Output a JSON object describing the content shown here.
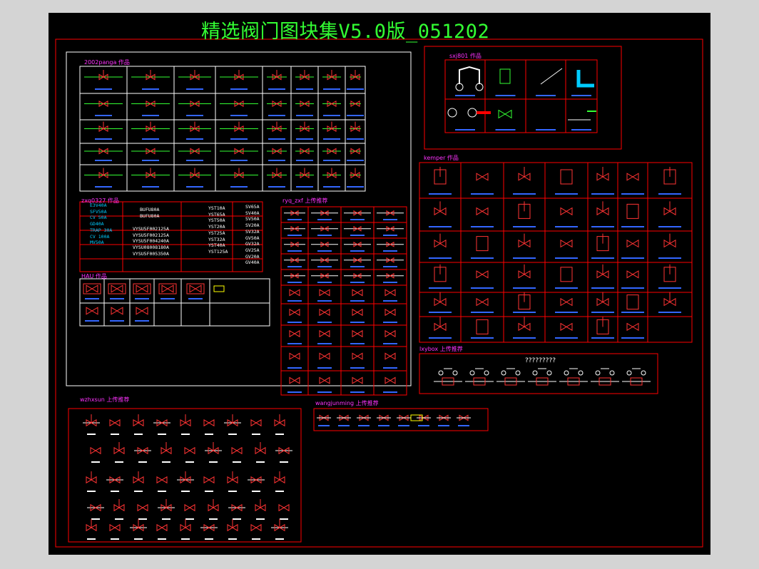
{
  "drawing": {
    "title": "精选阀门图块集V5.0版_051202",
    "colors": {
      "background": "#000000",
      "frame": "#ff0000",
      "title": "#33ff33",
      "label": "#ff33ff",
      "symbol": "#ff3333",
      "text": "#3366ff"
    }
  },
  "blocks": {
    "block_2002": "2002panga 作品",
    "block_zxq": "zxq0327 作品",
    "block_hau": "HAU 作品",
    "block_ryq": "ryq_zxf 上传推荐",
    "block_sxj": "sxj801 作品",
    "block_kemper": "kemper 作品",
    "block_lxybox": "lxybox 上传推荐",
    "block_wzhxsun": "wzhxsun 上传推荐",
    "block_wangjunming": "wangjunming 上传推荐",
    "lxybox_caption": "?????????"
  },
  "sxj_labels": [
    "闸阀",
    "截阀",
    "节流阀",
    "角阀",
    "平板闸阀",
    "闸阀",
    "止回阀",
    "止回阀"
  ],
  "kemper_labels": [
    "闸阀 手动",
    "闸阀_",
    "球阀_",
    "电磁阀",
    "电动阀",
    "阀(蝶)",
    "阀(气动)",
    "闸阀(手动)",
    "闸阀",
    "闸阀",
    "隔膜阀",
    "减压阀",
    "安全阀",
    "阀(手动)"
  ],
  "codes_left": [
    "E3V40A",
    "SFV50A",
    "CV 50A",
    "GD40A",
    "TRAP 30A",
    "CV 100A",
    "MV50A"
  ],
  "codes_mid_a": [
    "BUFU80A",
    "BUFU80A"
  ],
  "codes_mid_b": [
    "VYSU5F002125A",
    "VYSU5F002125A",
    "VYSU5F004240A",
    "VYSU08008180A",
    "VYSU5F005350A"
  ],
  "codes_right_a": [
    "YST10A",
    "YST65A",
    "YST50A",
    "YST20A",
    "YST25A",
    "YST32A",
    "YST40A",
    "YST125A"
  ],
  "codes_right_b": [
    "SV65A",
    "SV40A",
    "SV50A",
    "SV20A",
    "SV32A",
    "GV50A",
    "GV32A",
    "GV25A",
    "GV20A",
    "GV40A"
  ]
}
